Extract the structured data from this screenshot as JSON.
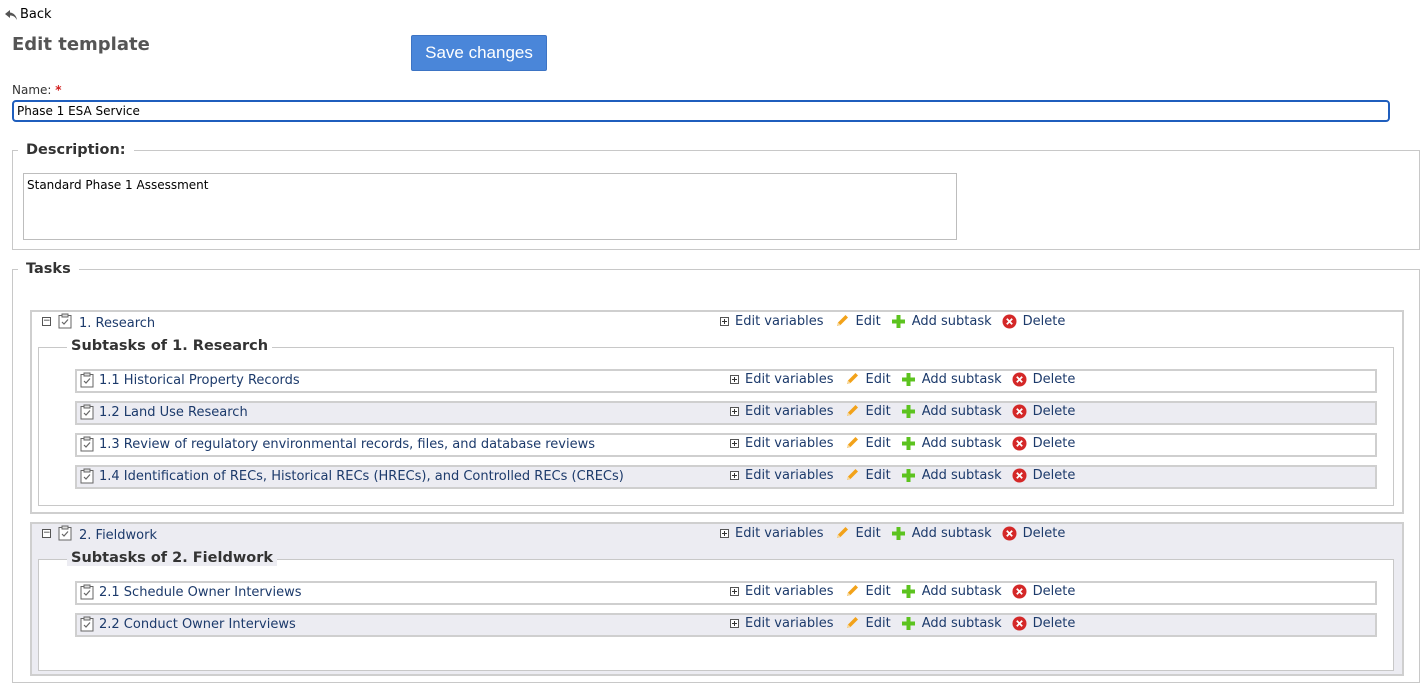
{
  "nav": {
    "back_label": "Back"
  },
  "page": {
    "title": "Edit template",
    "save_label": "Save changes"
  },
  "name_field": {
    "label": "Name:",
    "required_mark": "*",
    "value": "Phase 1 ESA Service"
  },
  "description": {
    "legend": "Description:",
    "value": "Standard Phase 1 Assessment"
  },
  "tasks": {
    "legend": "Tasks",
    "actions": {
      "edit_variables": "Edit variables",
      "edit": "Edit",
      "add_subtask": "Add subtask",
      "delete": "Delete"
    },
    "items": [
      {
        "title": "1. Research",
        "subtasks_legend": "Subtasks of 1. Research",
        "subtasks": [
          {
            "title": "1.1 Historical Property Records"
          },
          {
            "title": "1.2 Land Use Research"
          },
          {
            "title": "1.3 Review of regulatory environmental records, files, and database reviews"
          },
          {
            "title": "1.4 Identification of RECs, Historical RECs (HRECs), and Controlled RECs (CRECs)"
          }
        ]
      },
      {
        "title": "2. Fieldwork",
        "subtasks_legend": "Subtasks of 2. Fieldwork",
        "subtasks": [
          {
            "title": "2.1 Schedule Owner Interviews"
          },
          {
            "title": "2.2 Conduct Owner Interviews"
          }
        ]
      }
    ]
  },
  "icons": {
    "back": "back-arrow-icon",
    "toggle": "collapse-toggle-icon",
    "clipboard": "clipboard-icon",
    "expand_small": "expand-plus-icon",
    "edit": "pencil-icon",
    "add": "plus-icon",
    "delete": "delete-x-icon"
  },
  "colors": {
    "primary_button": "#4a86d9",
    "link": "#1c3a6b",
    "pencil": "#f2a21a",
    "plus": "#5cc31f",
    "delete": "#d42828"
  }
}
